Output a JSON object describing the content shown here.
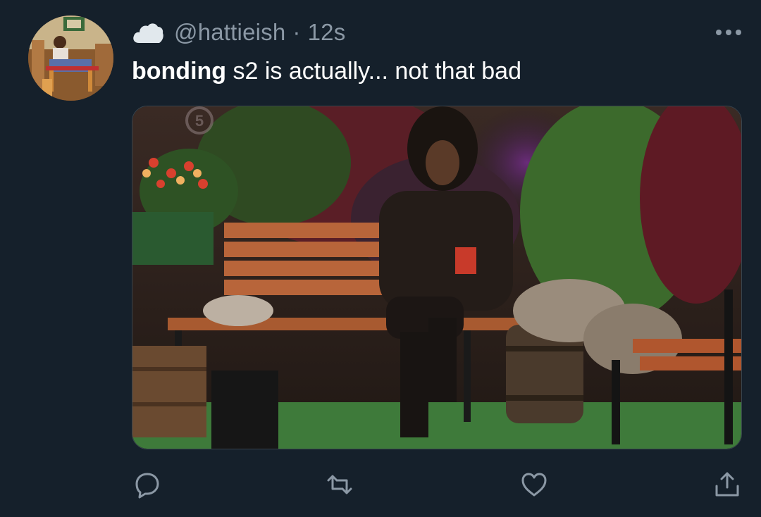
{
  "tweet": {
    "handle": "@hattieish",
    "separator": "·",
    "time": "12s",
    "text_bold": "bonding",
    "text_rest": " s2 is actually... not that bad",
    "media_watermark": "5"
  },
  "icons": {
    "avatar": "avatar",
    "display_name": "cloud-icon",
    "more": "more-horizontal-icon",
    "reply": "reply-icon",
    "retweet": "retweet-icon",
    "like": "heart-icon",
    "share": "share-icon"
  },
  "colors": {
    "background": "#15202b",
    "text_primary": "#ffffff",
    "text_secondary": "#8b98a5",
    "border": "#38444d"
  }
}
